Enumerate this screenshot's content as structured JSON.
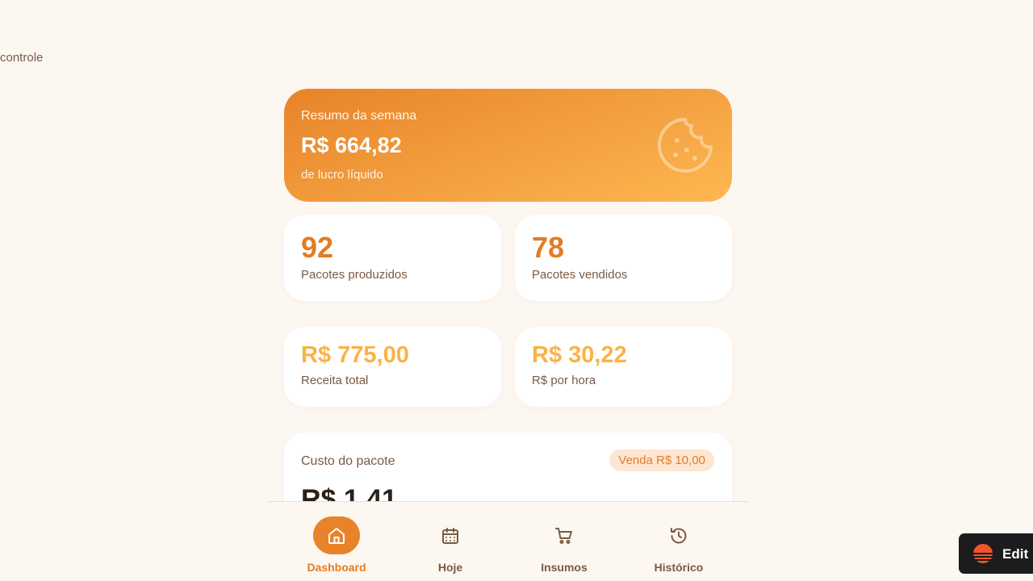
{
  "sidebar": {
    "fragment_text": "controle"
  },
  "hero": {
    "label": "Resumo da semana",
    "value": "R$ 664,82",
    "sublabel": "de lucro líquido",
    "icon": "cookie-icon"
  },
  "stats": [
    {
      "value": "92",
      "label": "Pacotes produzidos"
    },
    {
      "value": "78",
      "label": "Pacotes vendidos"
    },
    {
      "value": "R$ 775,00",
      "label": "Receita total"
    },
    {
      "value": "R$ 30,22",
      "label": "R$ por hora"
    }
  ],
  "cost": {
    "title": "Custo do pacote",
    "badge": "Venda R$ 10,00",
    "value": "R$ 1,41"
  },
  "nav": [
    {
      "label": "Dashboard",
      "icon": "home-icon",
      "active": true
    },
    {
      "label": "Hoje",
      "icon": "calendar-icon",
      "active": false
    },
    {
      "label": "Insumos",
      "icon": "cart-icon",
      "active": false
    },
    {
      "label": "Histórico",
      "icon": "history-icon",
      "active": false
    }
  ],
  "edit_badge": {
    "label": "Edit"
  },
  "colors": {
    "accent": "#e8832a",
    "accent_light": "#fbb245",
    "background": "#fdf7f2",
    "text": "#7a5a43"
  }
}
